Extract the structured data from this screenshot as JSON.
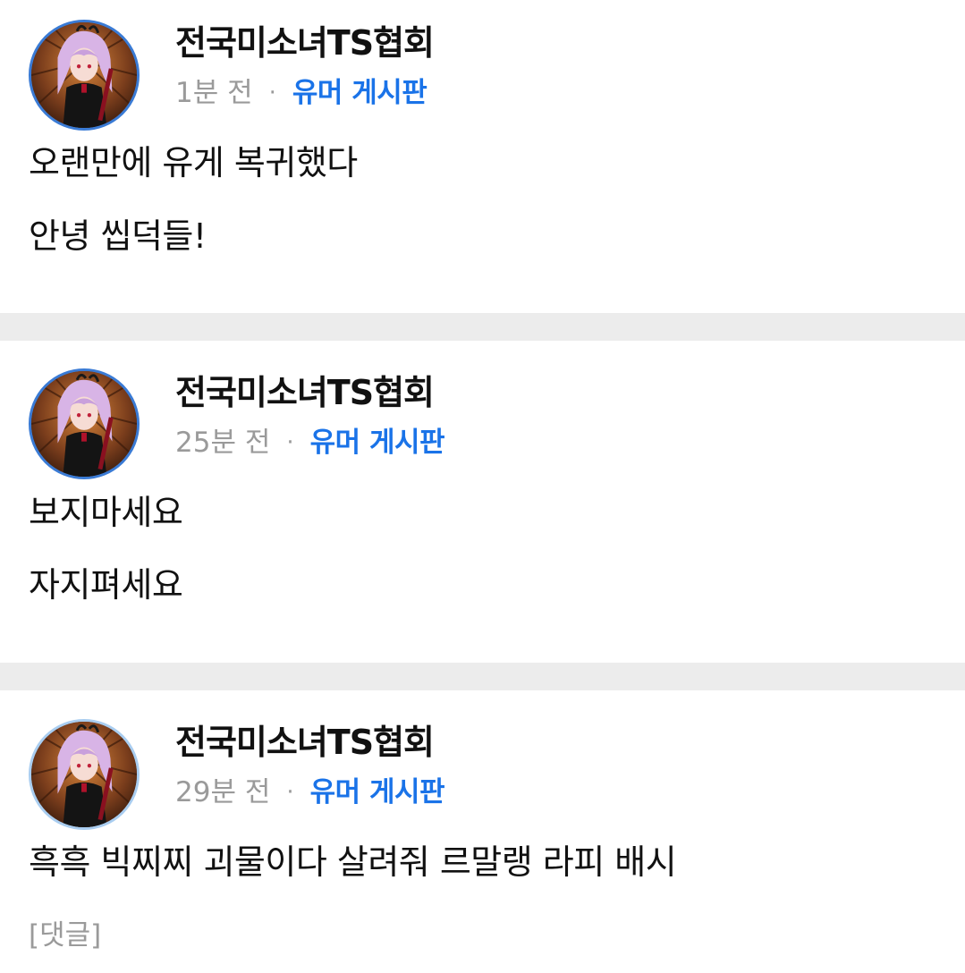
{
  "posts": [
    {
      "author": "전국미소녀TS협회",
      "time": "1분 전",
      "separator": "·",
      "board": "유머 게시판",
      "avatar_icon": "profile-avatar-anime",
      "lines": [
        "오랜만에 유게 복귀했다",
        "안녕 씹덕들!"
      ]
    },
    {
      "author": "전국미소녀TS협회",
      "time": "25분 전",
      "separator": "·",
      "board": "유머 게시판",
      "avatar_icon": "profile-avatar-anime",
      "lines": [
        "보지마세요",
        "자지펴세요"
      ]
    },
    {
      "author": "전국미소녀TS협회",
      "time": "29분 전",
      "separator": "·",
      "board": "유머 게시판",
      "avatar_icon": "profile-avatar-anime",
      "lines": [
        "흑흑 빅찌찌 괴물이다 살려줘 르말랭 라피 배시"
      ],
      "comment_link": "[댓글]"
    }
  ],
  "colors": {
    "board_link": "#1a73e8",
    "meta_gray": "#9a9a9a",
    "separator": "#ececec",
    "avatar_ring": "#3a7bd5"
  }
}
